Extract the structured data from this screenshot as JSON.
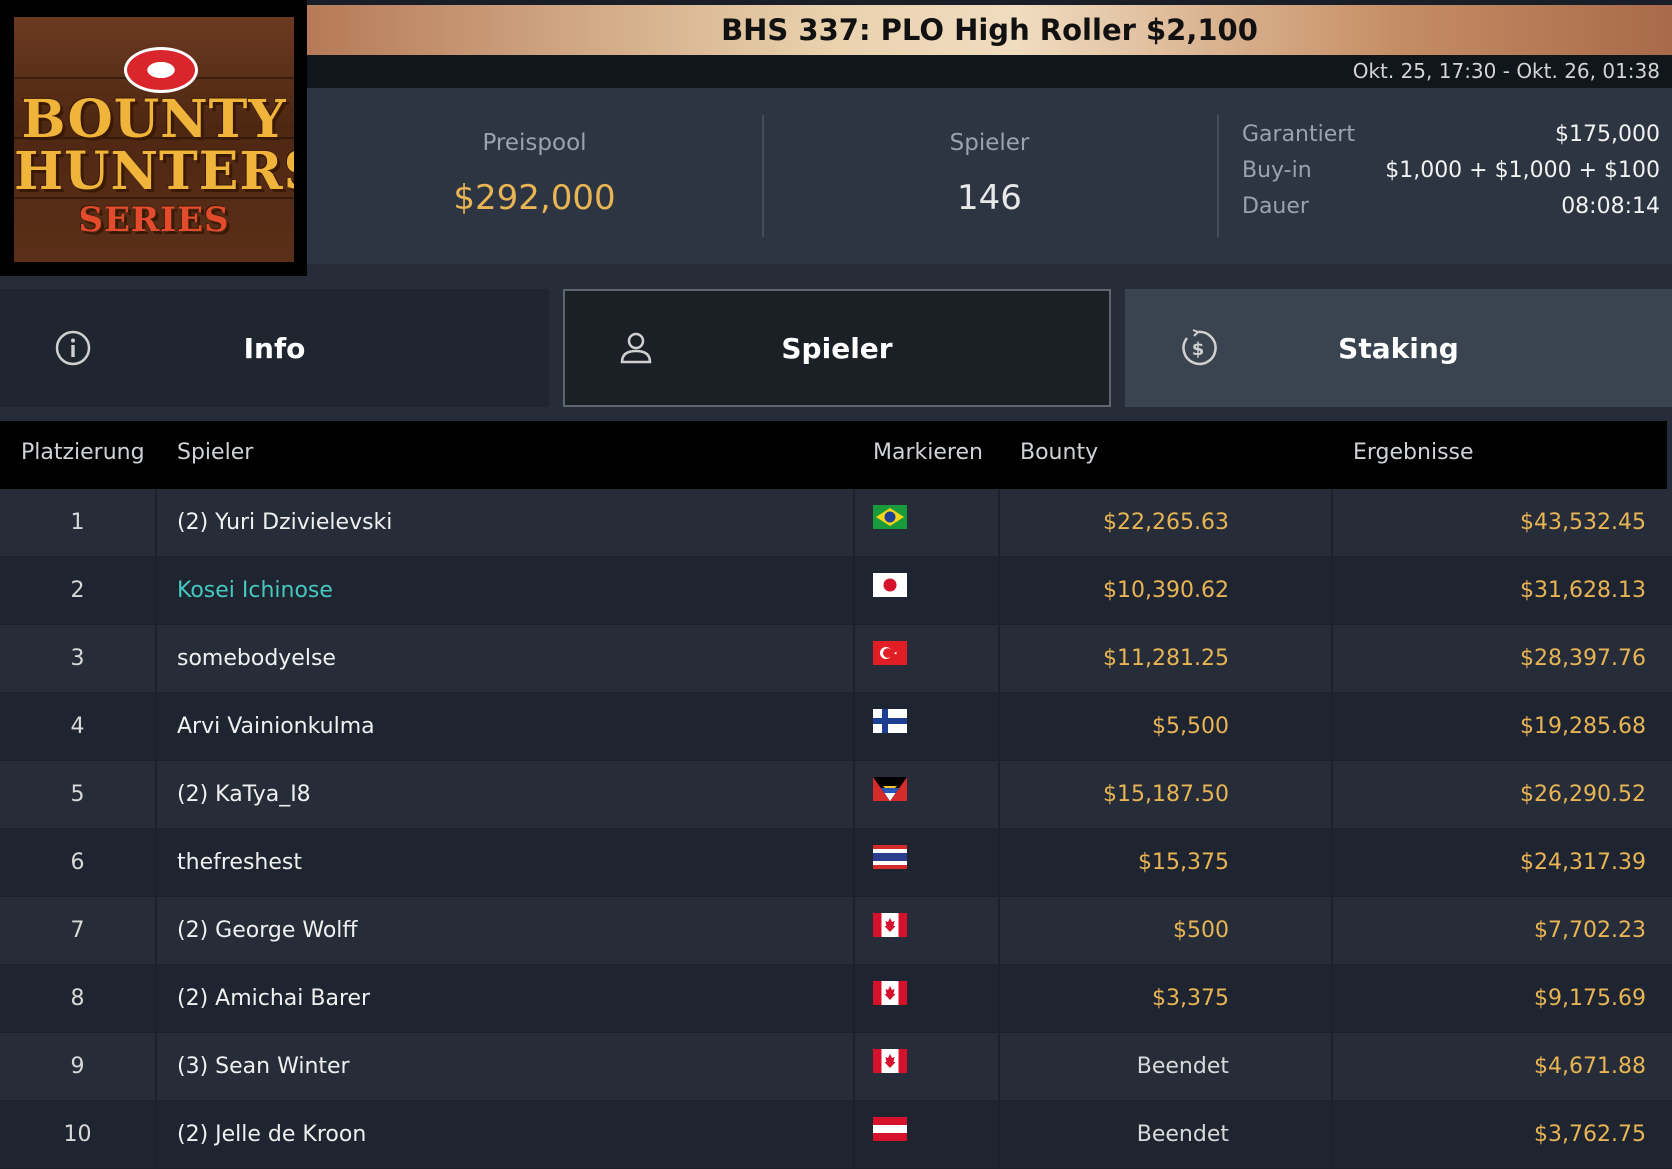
{
  "tournament": {
    "title": "BHS 337: PLO High Roller $2,100",
    "dates": "Okt. 25, 17:30 - Okt. 26, 01:38"
  },
  "logo": {
    "line1": "BOUNTY",
    "line2": "HUNTERS",
    "line3": "SERIES"
  },
  "stats": {
    "prize_pool_label": "Preispool",
    "prize_pool_value": "$292,000",
    "players_label": "Spieler",
    "players_value": "146",
    "details": [
      {
        "key": "Garantiert",
        "value": "$175,000"
      },
      {
        "key": "Buy-in",
        "value": "$1,000 + $1,000 + $100"
      },
      {
        "key": "Dauer",
        "value": "08:08:14"
      }
    ]
  },
  "tabs": [
    {
      "label": "Info",
      "icon": "info-icon"
    },
    {
      "label": "Spieler",
      "icon": "user-icon",
      "active": true
    },
    {
      "label": "Staking",
      "icon": "dollar-coin-icon"
    }
  ],
  "table": {
    "headers": {
      "rank": "Platzierung",
      "player": "Spieler",
      "flag": "Markieren",
      "bounty": "Bounty",
      "results": "Ergebnisse"
    },
    "rows": [
      {
        "rank": "1",
        "name": "(2) Yuri Dzivielevski",
        "country": "brazil",
        "bounty": "$22,265.63",
        "result": "$43,532.45"
      },
      {
        "rank": "2",
        "name": "Kosei Ichinose",
        "country": "japan",
        "bounty": "$10,390.62",
        "result": "$31,628.13",
        "highlight": true
      },
      {
        "rank": "3",
        "name": "somebodyelse",
        "country": "turkey",
        "bounty": "$11,281.25",
        "result": "$28,397.76"
      },
      {
        "rank": "4",
        "name": "Arvi Vainionkulma",
        "country": "finland",
        "bounty": "$5,500",
        "result": "$19,285.68"
      },
      {
        "rank": "5",
        "name": "(2) KaTya_I8",
        "country": "antigua",
        "bounty": "$15,187.50",
        "result": "$26,290.52"
      },
      {
        "rank": "6",
        "name": "thefreshest",
        "country": "thailand",
        "bounty": "$15,375",
        "result": "$24,317.39"
      },
      {
        "rank": "7",
        "name": "(2) George Wolff",
        "country": "canada",
        "bounty": "$500",
        "result": "$7,702.23"
      },
      {
        "rank": "8",
        "name": "(2) Amichai Barer",
        "country": "canada",
        "bounty": "$3,375",
        "result": "$9,175.69"
      },
      {
        "rank": "9",
        "name": "(3) Sean Winter",
        "country": "canada",
        "bounty": "Beendet",
        "result": "$4,671.88"
      },
      {
        "rank": "10",
        "name": "(2) Jelle de Kroon",
        "country": "austria",
        "bounty": "Beendet",
        "result": "$3,762.75"
      }
    ]
  },
  "colors": {
    "accent_gold": "#e8b454",
    "highlight_teal": "#46c7c0"
  }
}
